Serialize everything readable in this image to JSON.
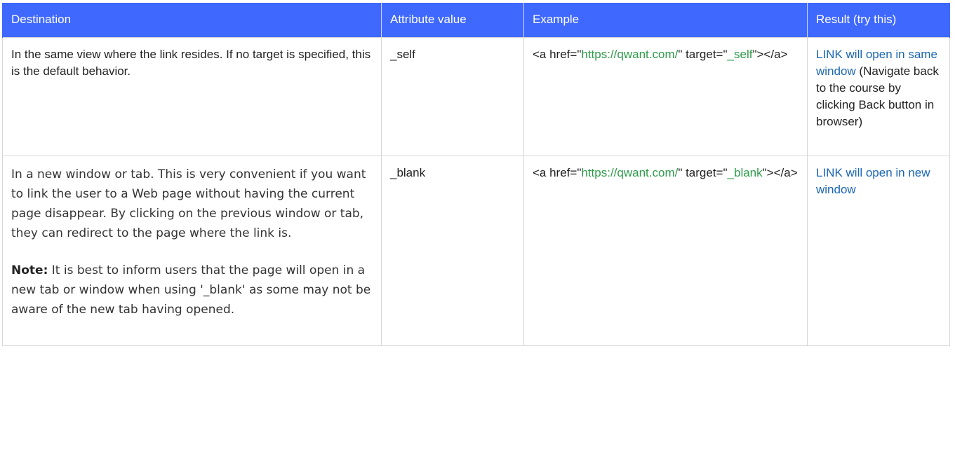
{
  "headers": {
    "destination": "Destination",
    "attribute_value": "Attribute value",
    "example": "Example",
    "result": "Result (try this)"
  },
  "rows": [
    {
      "destination": "In the same view where the link resides. If no target is specified, this is the default behavior.",
      "attribute_value": "_self",
      "example": {
        "prefix": "<a href=\"",
        "url": "https://qwant.com/",
        "middle": "\" target=\"",
        "target": "_self",
        "suffix": "\"></a>"
      },
      "result": {
        "link_line1": "LINK will open in same",
        "link_line2": "window",
        "trailing": " (Navigate back to the course by clicking Back button in browser)"
      }
    },
    {
      "destination_para1": "In a new window or tab. This is very convenient if you want to link the user to a Web page without having the current page disappear. By clicking on the previous window or tab, they can redirect to the page where the link is.",
      "note_label": "Note:",
      "note_text": " It is best to inform users that the page will open in a new tab or window when using '_blank' as some may not be aware of the new tab having opened.",
      "attribute_value": "_blank",
      "example": {
        "prefix": "<a href=\"",
        "url": "https://qwant.com/",
        "middle": "\" target=\"",
        "target": "_blank",
        "suffix": "\"></a>"
      },
      "result": {
        "link": "LINK will open in new window"
      }
    }
  ],
  "colors": {
    "header_bg": "#3f68ff",
    "header_text": "#ffffff",
    "code_green": "#2e9a4a",
    "link_blue": "#1a66b3",
    "border": "#d6d6d6"
  }
}
